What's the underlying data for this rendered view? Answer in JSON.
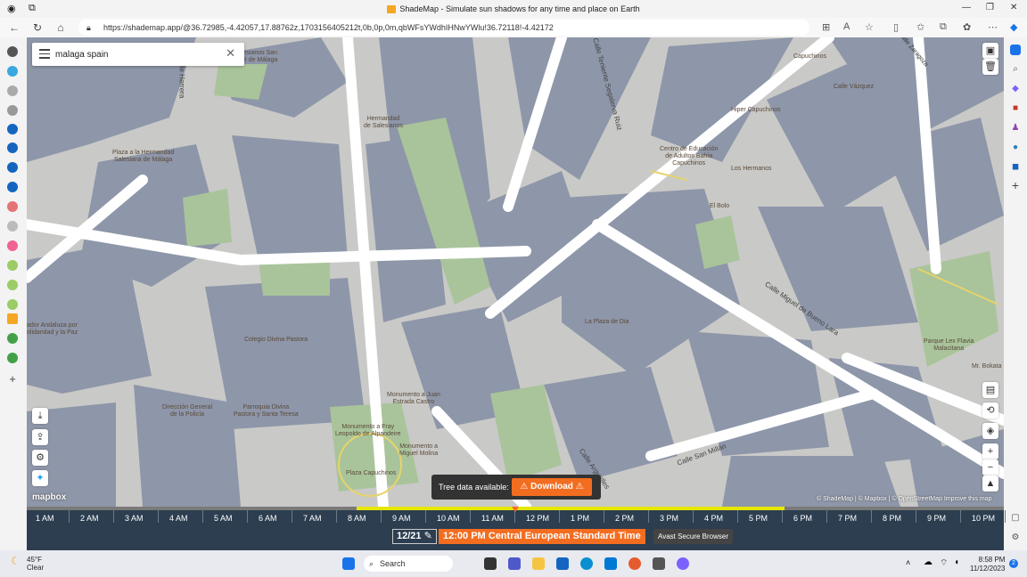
{
  "window": {
    "title": "ShadeMap - Simulate sun shadows for any time and place on Earth"
  },
  "browser": {
    "url": "https://shademap.app/@36.72985,-4.42057,17.88762z,1703156405212t,0b,0p,0m,qbWFsYWdhIHNwYWlu!36.72118!-4.42172"
  },
  "search": {
    "value": "malaga spain"
  },
  "map": {
    "labels": [
      "Salesianos San\nJosé de Málaga",
      "Hermandad\nde Salesianos",
      "Capuchinos",
      "Calle Zaragoza",
      "Calle Vázquez",
      "Hiper Capuchinos",
      "Centro de Educación\nde Adultos Bahía\nCapuchinos",
      "Los Hermanos",
      "El Bolo",
      "Plaza a la Hermandad\nSalesiana de Málaga",
      "Colegio Divina Pastora",
      "La Plaza de Dia",
      "Parque Lex Flavia\nMalacitana",
      "Monumento a Juan\nEstrada Castro",
      "Dirección General\nde la Policía",
      "Parroquia Divina\nPastora y Santa Teresa",
      "Monumento a Fray\nLeopoldo de Alpandeire",
      "Monumento a\nMiguel Molina",
      "Plaza Capuchinos",
      "ador Andaluza por\nolidaridad y la Paz",
      "Mr. Bokata"
    ],
    "streets": [
      "Calle Teniente Segalerva Ruiz",
      "Calle Miguel de Bueno Lara",
      "Calle San Millán",
      "Calle Arguelles",
      "Calle Herrera"
    ]
  },
  "tree_bar": {
    "label": "Tree data available:",
    "download": "Download"
  },
  "attribution": "© ShadeMap | © Mapbox | © OpenStreetMap  Improve this map",
  "mapbox_logo": "mapbox",
  "timeline": {
    "hours": [
      "1 AM",
      "2 AM",
      "3 AM",
      "4 AM",
      "5 AM",
      "6 AM",
      "7 AM",
      "8 AM",
      "9 AM",
      "10 AM",
      "11 AM",
      "12 PM",
      "1 PM",
      "2 PM",
      "3 PM",
      "4 PM",
      "5 PM",
      "6 PM",
      "7 PM",
      "8 PM",
      "9 PM",
      "10 PM"
    ],
    "date": "12/21",
    "time": "12:00 PM Central European Standard Time",
    "avast": "Avast Secure Browser"
  },
  "taskbar": {
    "weather_temp": "45°F",
    "weather_desc": "Clear",
    "search": "Search",
    "time": "8:58 PM",
    "date": "11/12/2023"
  },
  "colors": {
    "accent": "#f36d21",
    "timeline_bg": "#2c3e50",
    "daylight": "#e6e600"
  }
}
